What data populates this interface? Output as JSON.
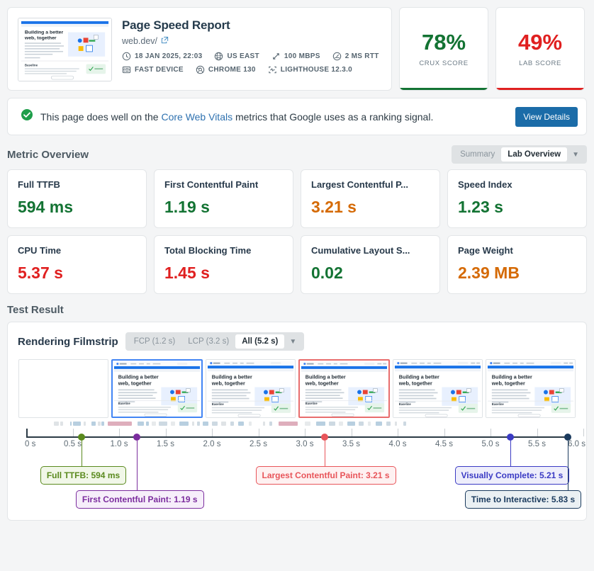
{
  "report": {
    "title": "Page Speed Report",
    "url": "web.dev/",
    "thumbnail_heading_line1": "Building a better",
    "thumbnail_heading_line2": "web, together",
    "facts_row1": [
      {
        "icon": "clock-icon",
        "label": "18 JAN 2025, 22:03"
      },
      {
        "icon": "globe-icon",
        "label": "US EAST"
      },
      {
        "icon": "bandwidth-icon",
        "label": "100 MBPS"
      },
      {
        "icon": "latency-gauge-icon",
        "label": "2 MS RTT"
      }
    ],
    "facts_row2": [
      {
        "icon": "device-icon",
        "label": "FAST DEVICE"
      },
      {
        "icon": "chrome-icon",
        "label": "CHROME 130"
      },
      {
        "icon": "lighthouse-icon",
        "label": "LIGHTHOUSE 12.3.0"
      }
    ]
  },
  "scores": [
    {
      "value": "78%",
      "label": "CRUX SCORE",
      "color": "#137333"
    },
    {
      "value": "49%",
      "label": "LAB SCORE",
      "color": "#e02020"
    }
  ],
  "banner": {
    "text_before": "This page does well on the ",
    "link": "Core Web Vitals",
    "text_after": " metrics that Google uses as a ranking signal.",
    "button": "View Details",
    "status_color": "#1e9e4a"
  },
  "metric_overview": {
    "title": "Metric Overview",
    "toggle": {
      "inactive": "Summary",
      "active": "Lab Overview",
      "caret": "▼"
    },
    "metrics": [
      {
        "label": "Full TTFB",
        "value": "594 ms",
        "color": "#137333"
      },
      {
        "label": "First Contentful Paint",
        "value": "1.19 s",
        "color": "#137333"
      },
      {
        "label": "Largest Contentful P...",
        "value": "3.21 s",
        "color": "#d56a05"
      },
      {
        "label": "Speed Index",
        "value": "1.23 s",
        "color": "#137333"
      },
      {
        "label": "CPU Time",
        "value": "5.37 s",
        "color": "#e02020"
      },
      {
        "label": "Total Blocking Time",
        "value": "1.45 s",
        "color": "#e02020"
      },
      {
        "label": "Cumulative Layout S...",
        "value": "0.02",
        "color": "#137333"
      },
      {
        "label": "Page Weight",
        "value": "2.39 MB",
        "color": "#d56a05"
      }
    ]
  },
  "test_result": {
    "title": "Test Result",
    "filmstrip": {
      "title": "Rendering Filmstrip",
      "options": [
        {
          "label": "FCP (1.2 s)",
          "active": false
        },
        {
          "label": "LCP (3.2 s)",
          "active": false
        },
        {
          "label": "All (5.2 s)",
          "active": true
        }
      ],
      "caret": "▼"
    }
  },
  "chart_data": {
    "type": "timeline",
    "title": "Rendering Filmstrip",
    "xlabel": "",
    "xlim": [
      0,
      6.0
    ],
    "grid": true,
    "tick_labels": [
      "0 s",
      "0.5 s",
      "1.0 s",
      "1.5 s",
      "2.0 s",
      "2.5 s",
      "3.0 s",
      "3.5 s",
      "4.0 s",
      "4.5 s",
      "5.0 s",
      "5.5 s",
      "6.0 s"
    ],
    "tick_values": [
      0,
      0.5,
      1.0,
      1.5,
      2.0,
      2.5,
      3.0,
      3.5,
      4.0,
      4.5,
      5.0,
      5.5,
      6.0
    ],
    "events": [
      {
        "name": "Full TTFB",
        "value": 0.594,
        "label": "Full TTFB: 594 ms",
        "color": "#5a8a1e",
        "bg": "#f1f7e8",
        "row": 0
      },
      {
        "name": "First Contentful Paint",
        "value": 1.19,
        "label": "First Contentful Paint: 1.19 s",
        "color": "#7b2d9e",
        "bg": "#f6eefa",
        "row": 1
      },
      {
        "name": "Largest Contentful Paint",
        "value": 3.21,
        "label": "Largest Contentful Paint: 3.21 s",
        "color": "#e8555a",
        "bg": "#fef1f1",
        "row": 0
      },
      {
        "name": "Visually Complete",
        "value": 5.21,
        "label": "Visually Complete: 5.21 s",
        "color": "#3b3bc4",
        "bg": "#eeeefb",
        "row": 0
      },
      {
        "name": "Time to Interactive",
        "value": 5.83,
        "label": "Time to Interactive: 5.83 s",
        "color": "#1b3b5e",
        "bg": "#eaf0f3",
        "row": 1
      }
    ],
    "frames": [
      {
        "index": 0,
        "state": "blank",
        "highlight": "none"
      },
      {
        "index": 1,
        "state": "partial",
        "highlight": "blue"
      },
      {
        "index": 2,
        "state": "partial",
        "highlight": "none"
      },
      {
        "index": 3,
        "state": "full",
        "highlight": "lcp"
      },
      {
        "index": 4,
        "state": "full",
        "highlight": "none"
      },
      {
        "index": 5,
        "state": "full",
        "highlight": "none"
      }
    ],
    "waterfall_segments": [
      {
        "start": 0.3,
        "width": 0.05,
        "color": "#dfe3e6"
      },
      {
        "start": 0.37,
        "width": 0.03,
        "color": "#dfe3e6"
      },
      {
        "start": 0.47,
        "width": 0.02,
        "color": "#b8cfe0"
      },
      {
        "start": 0.5,
        "width": 0.09,
        "color": "#b8cfe0"
      },
      {
        "start": 0.62,
        "width": 0.02,
        "color": "#dfe3e6"
      },
      {
        "start": 0.7,
        "width": 0.05,
        "color": "#b8cfe0"
      },
      {
        "start": 0.77,
        "width": 0.03,
        "color": "#dfe3e6"
      },
      {
        "start": 0.81,
        "width": 0.03,
        "color": "#b8cfe0"
      },
      {
        "start": 0.88,
        "width": 0.26,
        "color": "#deaebc"
      },
      {
        "start": 1.2,
        "width": 0.07,
        "color": "#b8cfe0"
      },
      {
        "start": 1.29,
        "width": 0.03,
        "color": "#b8cfe0"
      },
      {
        "start": 1.35,
        "width": 0.05,
        "color": "#e7eaec"
      },
      {
        "start": 1.43,
        "width": 0.09,
        "color": "#cdd9e2"
      },
      {
        "start": 1.56,
        "width": 0.04,
        "color": "#e7eaec"
      },
      {
        "start": 1.65,
        "width": 0.1,
        "color": "#b8cfe0"
      },
      {
        "start": 1.79,
        "width": 0.02,
        "color": "#dfe3e6"
      },
      {
        "start": 1.84,
        "width": 0.03,
        "color": "#cdd9e2"
      },
      {
        "start": 1.9,
        "width": 0.06,
        "color": "#b8cfe0"
      },
      {
        "start": 2.0,
        "width": 0.06,
        "color": "#cdd9e2"
      },
      {
        "start": 2.1,
        "width": 0.05,
        "color": "#dfe3e6"
      },
      {
        "start": 2.2,
        "width": 0.04,
        "color": "#cdd9e2"
      },
      {
        "start": 2.28,
        "width": 0.06,
        "color": "#b8cfe0"
      },
      {
        "start": 2.4,
        "width": 0.03,
        "color": "#e7eaec"
      },
      {
        "start": 2.55,
        "width": 0.02,
        "color": "#dfe3e6"
      },
      {
        "start": 2.62,
        "width": 0.03,
        "color": "#cdd9e2"
      },
      {
        "start": 2.72,
        "width": 0.2,
        "color": "#deaebc"
      },
      {
        "start": 3.0,
        "width": 0.06,
        "color": "#e7eaec"
      },
      {
        "start": 3.12,
        "width": 0.1,
        "color": "#b8cfe0"
      },
      {
        "start": 3.26,
        "width": 0.07,
        "color": "#cdd9e2"
      },
      {
        "start": 3.37,
        "width": 0.04,
        "color": "#e7eaec"
      },
      {
        "start": 3.46,
        "width": 0.08,
        "color": "#b8cfe0"
      },
      {
        "start": 3.58,
        "width": 0.05,
        "color": "#cdd9e2"
      },
      {
        "start": 3.68,
        "width": 0.03,
        "color": "#e7eaec"
      },
      {
        "start": 3.76,
        "width": 0.07,
        "color": "#b8cfe0"
      },
      {
        "start": 3.88,
        "width": 0.04,
        "color": "#cdd9e2"
      },
      {
        "start": 3.97,
        "width": 0.02,
        "color": "#dfe3e6"
      },
      {
        "start": 4.06,
        "width": 0.03,
        "color": "#cdd9e2"
      }
    ]
  }
}
